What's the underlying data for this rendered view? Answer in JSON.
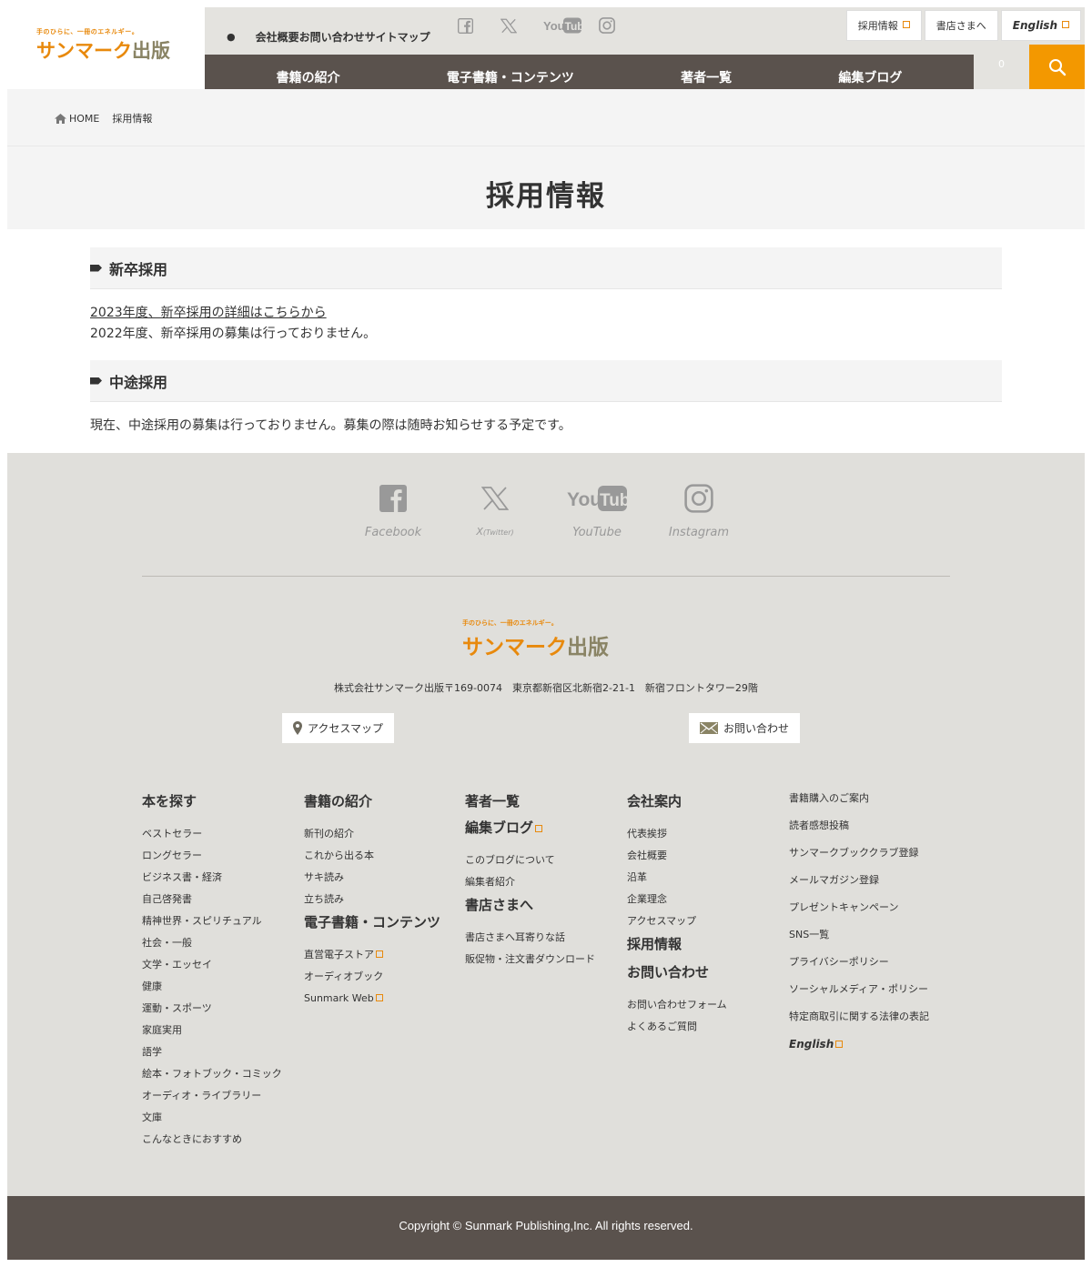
{
  "logo": {
    "tagline": "手のひらに、一冊のエネルギー。",
    "name_orange": "サンマーク",
    "name_dark": "出版"
  },
  "header": {
    "top_links": [
      "会社概要",
      "お問い合わせ",
      "サイトマップ"
    ],
    "social_icons": [
      "facebook-icon",
      "x-icon",
      "youtube-icon",
      "instagram-icon"
    ],
    "utility_buttons": {
      "recruit": "採用情報",
      "bookstore": "書店さまへ",
      "english": "English"
    },
    "main_nav": [
      "書籍の紹介",
      "電子書籍・コンテンツ",
      "著者一覧",
      "編集ブログ"
    ],
    "cart_count": "0"
  },
  "breadcrumb": {
    "home": "HOME",
    "current": "採用情報"
  },
  "page_title": "採用情報",
  "sections": {
    "new_grad": {
      "heading": "新卒採用",
      "link_text": "2023年度、新卒採用の詳細はこちらから",
      "text": "2022年度、新卒採用の募集は行っておりません。"
    },
    "mid_career": {
      "heading": "中途採用",
      "text": "現在、中途採用の募集は行っておりません。募集の際は随時お知らせする予定です。"
    }
  },
  "footer": {
    "social": {
      "facebook": "Facebook",
      "x": "X",
      "x_sub": "(Twitter)",
      "youtube": "YouTube",
      "instagram": "Instagram"
    },
    "address": "株式会社サンマーク出版〒169-0074　東京都新宿区北新宿2-21-1　新宿フロントタワー29階",
    "access_map": "アクセスマップ",
    "contact": "お問い合わせ",
    "col1": {
      "heading": "本を探す",
      "items": [
        "ベストセラー",
        "ロングセラー",
        "ビジネス書・経済",
        "自己啓発書",
        "精神世界・スピリチュアル",
        "社会・一般",
        "文学・エッセイ",
        "健康",
        "運動・スポーツ",
        "家庭実用",
        "語学",
        "絵本・フォトブック・コミック",
        "オーディオ・ライブラリー",
        "文庫",
        "こんなときにおすすめ"
      ]
    },
    "col2": {
      "heading": "書籍の紹介",
      "items": [
        "新刊の紹介",
        "これから出る本",
        "サキ読み",
        "立ち読み"
      ],
      "heading2": "電子書籍・コンテンツ",
      "items2": [
        "直営電子ストア",
        "オーディオブック",
        "Sunmark Web"
      ]
    },
    "col3": {
      "heading": "著者一覧",
      "heading2": "編集ブログ",
      "items2": [
        "このブログについて",
        "編集者紹介"
      ],
      "heading3": "書店さまへ",
      "items3": [
        "書店さまへ耳寄りな話",
        "販促物・注文書ダウンロード"
      ]
    },
    "col4": {
      "heading": "会社案内",
      "items": [
        "代表挨拶",
        "会社概要",
        "沿革",
        "企業理念",
        "アクセスマップ"
      ],
      "heading2": "採用情報",
      "heading3": "お問い合わせ",
      "items3": [
        "お問い合わせフォーム",
        "よくあるご質問"
      ]
    },
    "col5": {
      "items": [
        "書籍購入のご案内",
        "読者感想投稿",
        "サンマークブッククラブ登録",
        "メールマガジン登録",
        "プレゼントキャンペーン",
        "SNS一覧",
        "プライバシーポリシー",
        "ソーシャルメディア・ポリシー",
        "特定商取引に関する法律の表記"
      ],
      "english": "English"
    }
  },
  "copyright": "Copyright © Sunmark Publishing,Inc. All rights reserved.",
  "colors": {
    "accent": "#f39800",
    "brand_orange": "#e8890c",
    "nav_bg": "#5a524d",
    "footer_bg": "#e0dfdb"
  }
}
